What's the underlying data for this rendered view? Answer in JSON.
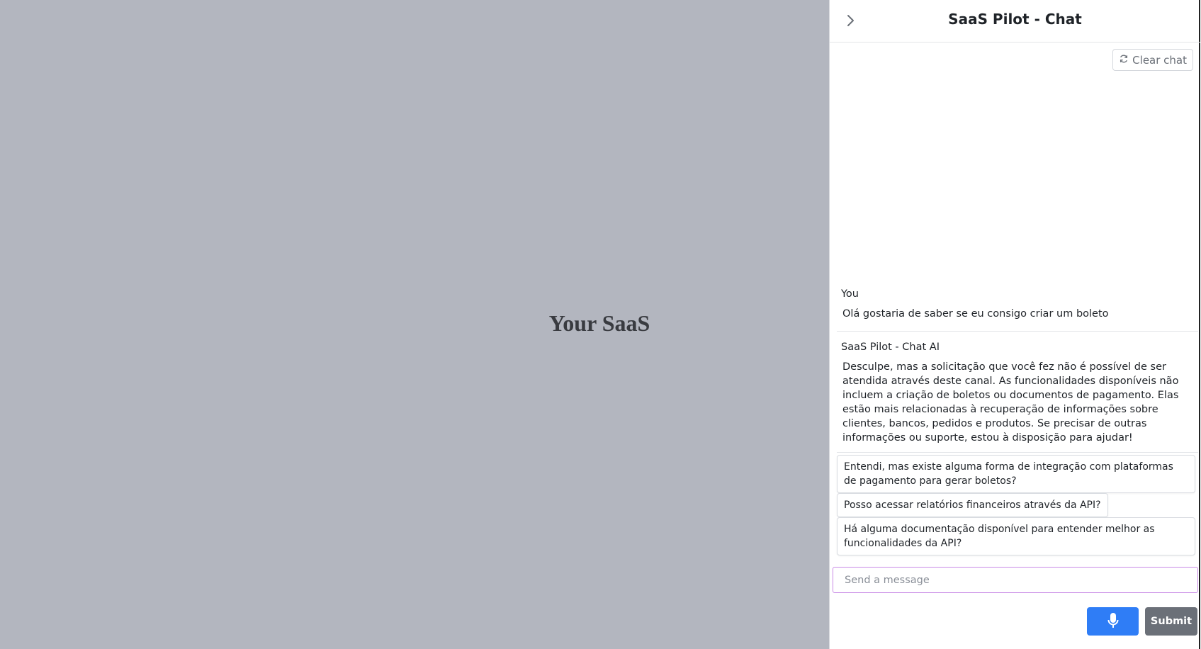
{
  "background": {
    "brand_text": "Your SaaS"
  },
  "chat": {
    "title": "SaaS Pilot - Chat",
    "collapse_icon": "chevron-right-icon",
    "clear_button": {
      "label": "Clear chat",
      "icon": "refresh-icon"
    },
    "messages": [
      {
        "author": "You",
        "text": "Olá gostaria de saber se eu consigo criar um boleto"
      },
      {
        "author": "SaaS Pilot - Chat AI",
        "text": "Desculpe, mas a solicitação que você fez não é possível de ser atendida através deste canal. As funcionalidades disponíveis não incluem a criação de boletos ou documentos de pagamento. Elas estão mais relacionadas à recuperação de informações sobre clientes, bancos, pedidos e produtos. Se precisar de outras informações ou suporte, estou à disposição para ajudar!"
      }
    ],
    "suggestions": [
      "Entendi, mas existe alguma forma de integração com plataformas de pagamento para gerar boletos?",
      "Posso acessar relatórios financeiros através da API?",
      "Há alguma documentação disponível para entender melhor as funcionalidades da API?"
    ],
    "input": {
      "placeholder": "Send a message",
      "value": ""
    },
    "mic_icon": "microphone-icon",
    "submit_label": "Submit"
  },
  "colors": {
    "backdrop": "#b3b6bf",
    "mic_button": "#2f7df6",
    "submit_button": "#6b7078",
    "input_focus_border": "#c98ae6"
  }
}
